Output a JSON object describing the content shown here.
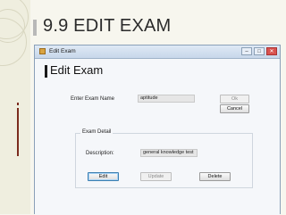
{
  "slide": {
    "title": "9.9 EDIT EXAM"
  },
  "window": {
    "title": "Edit Exam",
    "controls": {
      "minimize": "–",
      "maximize": "□",
      "close": "✕"
    },
    "heading": "Edit Exam",
    "exam_name_label": "Enter Exam Name",
    "exam_name_value": "aptitude",
    "ok_label": "Ok",
    "cancel_label": "Cancel",
    "group_title": "Exam Detail",
    "description_label": "Description:",
    "description_value": "general knowledge test",
    "edit_label": "Edit",
    "update_label": "Update",
    "delete_label": "Delete"
  }
}
